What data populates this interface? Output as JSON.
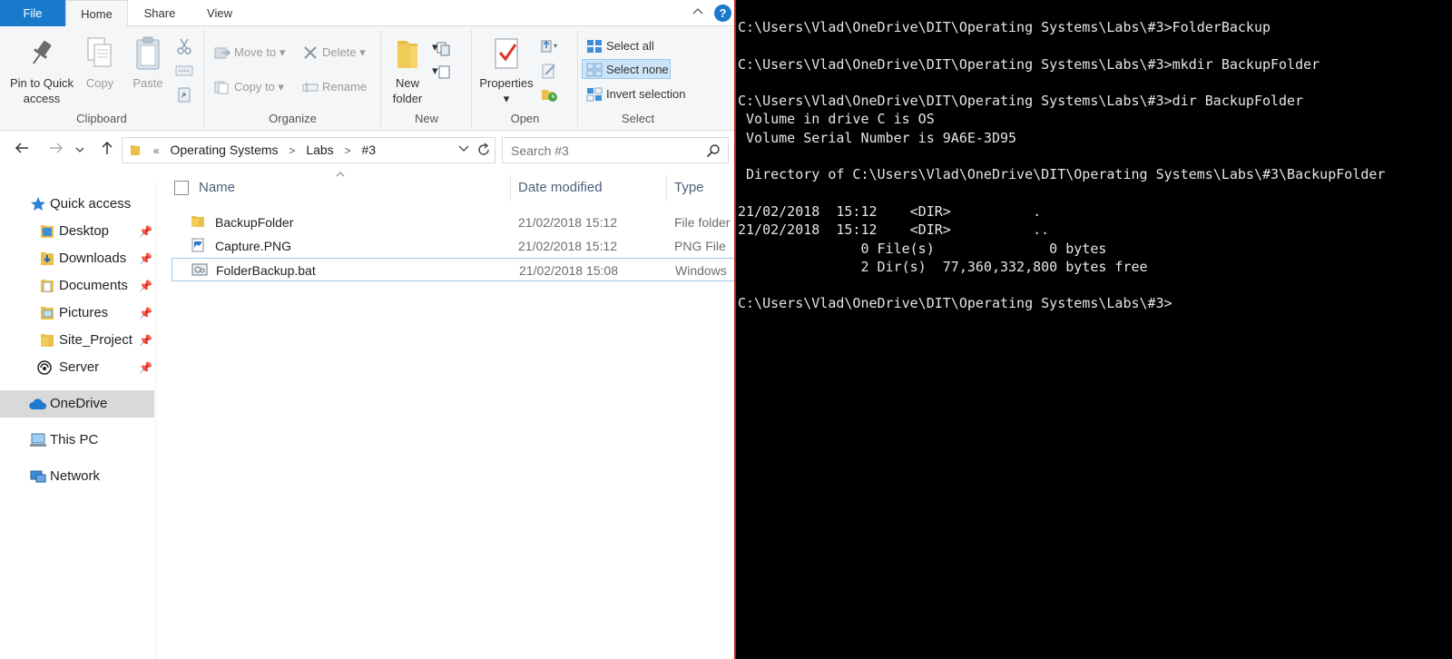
{
  "explorer": {
    "tabs": [
      {
        "label": "File"
      },
      {
        "label": "Home"
      },
      {
        "label": "Share"
      },
      {
        "label": "View"
      }
    ],
    "help_glyph": "?",
    "ribbon": {
      "clipboard": {
        "label": "Clipboard",
        "pin_line1": "Pin to Quick",
        "pin_line2": "access",
        "copy": "Copy",
        "paste": "Paste"
      },
      "organize": {
        "label": "Organize",
        "move_to": "Move to",
        "copy_to": "Copy to",
        "delete": "Delete",
        "rename": "Rename"
      },
      "new": {
        "label": "New",
        "new_folder_line1": "New",
        "new_folder_line2": "folder"
      },
      "open": {
        "label": "Open",
        "properties": "Properties"
      },
      "select": {
        "label": "Select",
        "select_all": "Select all",
        "select_none": "Select none",
        "invert_selection": "Invert selection"
      }
    },
    "address": {
      "overflow": "«",
      "crumbs": [
        "Operating Systems",
        "Labs",
        "#3"
      ],
      "separator": ">"
    },
    "search": {
      "placeholder": "Search #3"
    },
    "nav_pane": {
      "quick_access": "Quick access",
      "pinned": [
        "Desktop",
        "Downloads",
        "Documents",
        "Pictures",
        "Site_Project",
        "Server"
      ],
      "onedrive": "OneDrive",
      "this_pc": "This PC",
      "network": "Network"
    },
    "columns": {
      "name": "Name",
      "date_modified": "Date modified",
      "type": "Type"
    },
    "files": [
      {
        "name": "BackupFolder",
        "date": "21/02/2018 15:12",
        "type": "File folder"
      },
      {
        "name": "Capture.PNG",
        "date": "21/02/2018 15:12",
        "type": "PNG File"
      },
      {
        "name": "FolderBackup.bat",
        "date": "21/02/2018 15:08",
        "type": "Windows"
      }
    ],
    "colors": {
      "accent": "#1979ca",
      "folder": "#e8c04a",
      "selection": "#cce4f7"
    }
  },
  "console": {
    "lines": [
      "C:\\Users\\Vlad\\OneDrive\\DIT\\Operating Systems\\Labs\\#3>FolderBackup",
      "",
      "C:\\Users\\Vlad\\OneDrive\\DIT\\Operating Systems\\Labs\\#3>mkdir BackupFolder",
      "",
      "C:\\Users\\Vlad\\OneDrive\\DIT\\Operating Systems\\Labs\\#3>dir BackupFolder",
      " Volume in drive C is OS",
      " Volume Serial Number is 9A6E-3D95",
      "",
      " Directory of C:\\Users\\Vlad\\OneDrive\\DIT\\Operating Systems\\Labs\\#3\\BackupFolder",
      "",
      "21/02/2018  15:12    <DIR>          .",
      "21/02/2018  15:12    <DIR>          ..",
      "               0 File(s)              0 bytes",
      "               2 Dir(s)  77,360,332,800 bytes free",
      "",
      "C:\\Users\\Vlad\\OneDrive\\DIT\\Operating Systems\\Labs\\#3>"
    ]
  }
}
